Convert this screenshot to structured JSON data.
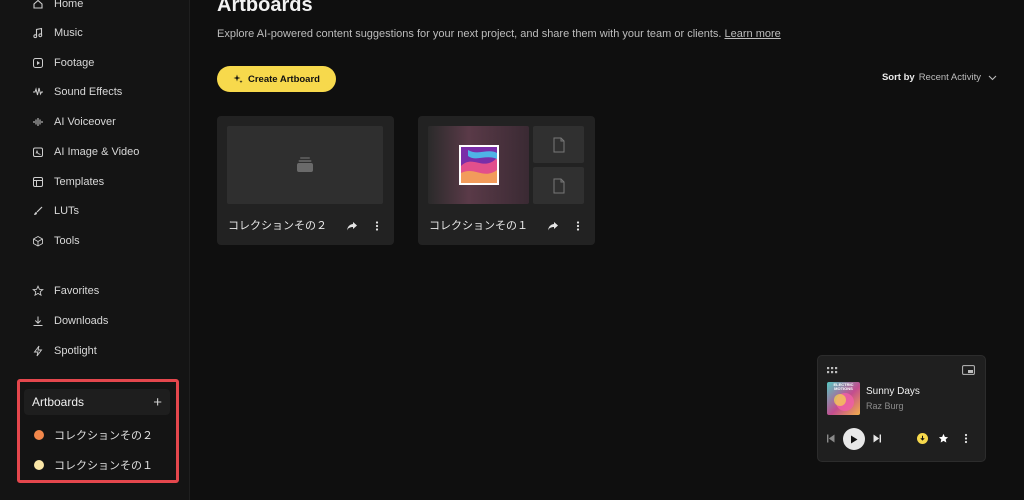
{
  "sidebar": {
    "nav": [
      {
        "label": "Home",
        "icon": "home-icon"
      },
      {
        "label": "Music",
        "icon": "music-note-icon"
      },
      {
        "label": "Footage",
        "icon": "play-square-icon"
      },
      {
        "label": "Sound Effects",
        "icon": "waveform-icon"
      },
      {
        "label": "AI Voiceover",
        "icon": "voice-wave-icon"
      },
      {
        "label": "AI Image & Video",
        "icon": "image-sparkle-icon"
      },
      {
        "label": "Templates",
        "icon": "template-icon"
      },
      {
        "label": "LUTs",
        "icon": "brush-icon"
      },
      {
        "label": "Tools",
        "icon": "cube-icon"
      }
    ],
    "secondary": [
      {
        "label": "Favorites",
        "icon": "star-icon"
      },
      {
        "label": "Downloads",
        "icon": "download-icon"
      },
      {
        "label": "Spotlight",
        "icon": "lightning-icon"
      }
    ],
    "artboards": {
      "title": "Artboards",
      "add_symbol": "+",
      "items": [
        {
          "label": "コレクションその２",
          "color": "#f2874b"
        },
        {
          "label": "コレクションその１",
          "color": "#fbe7a7"
        }
      ]
    }
  },
  "main": {
    "title": "Artboards",
    "subtitle": "Explore AI-powered content suggestions for your next project, and share them with your team or clients.",
    "learn_more": "Learn more",
    "create_button": "Create Artboard",
    "sort_label": "Sort by",
    "sort_value": "Recent Activity",
    "cards": [
      {
        "name": "コレクションその２"
      },
      {
        "name": "コレクションその１"
      }
    ]
  },
  "player": {
    "track_title": "Sunny Days",
    "artist": "Raz Burg",
    "cover_text": "ELECTRIC MOTIONS"
  },
  "colors": {
    "accent": "#f7d94c",
    "highlight_border": "#e4474d"
  }
}
